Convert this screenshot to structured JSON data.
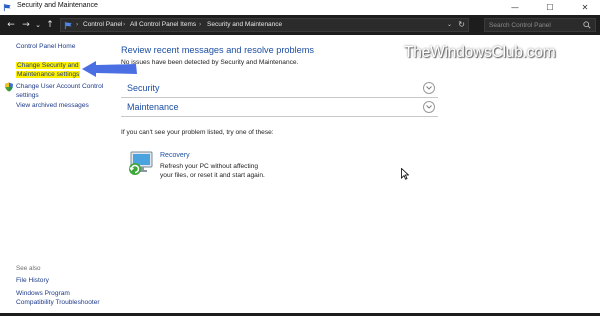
{
  "window": {
    "title": "Security and Maintenance",
    "controls": {
      "minimize": "—",
      "maximize": "☐",
      "close": "✕"
    }
  },
  "addressbar": {
    "back": "←",
    "forward": "→",
    "recent": "⌄",
    "up": "↑",
    "breadcrumbs": [
      "Control Panel",
      "All Control Panel Items",
      "Security and Maintenance"
    ],
    "separator": "›",
    "dropdown": "⌄",
    "refresh": "↻",
    "search_placeholder": "Search Control Panel"
  },
  "sidebar": {
    "home": "Control Panel Home",
    "change_settings_line1": "Change Security and",
    "change_settings_line2": "Maintenance settings",
    "uac_line1": "Change User Account Control",
    "uac_line2": "settings",
    "archived": "View archived messages",
    "see_also": "See also",
    "file_history": "File History",
    "compat_line1": "Windows Program",
    "compat_line2": "Compatibility Troubleshooter"
  },
  "main": {
    "heading": "Review recent messages and resolve problems",
    "status": "No issues have been detected by Security and Maintenance.",
    "sections": [
      "Security",
      "Maintenance"
    ],
    "try_text": "If you can't see your problem listed, try one of these:",
    "recovery": {
      "title": "Recovery",
      "desc_line1": "Refresh your PC without affecting",
      "desc_line2": "your files, or reset it and start again."
    }
  },
  "watermark": "TheWindowsClub.com",
  "colors": {
    "link": "#1d4fa3",
    "highlight": "#fff200",
    "arrow": "#4a6fe3",
    "addressbar": "#1d1d1d"
  }
}
